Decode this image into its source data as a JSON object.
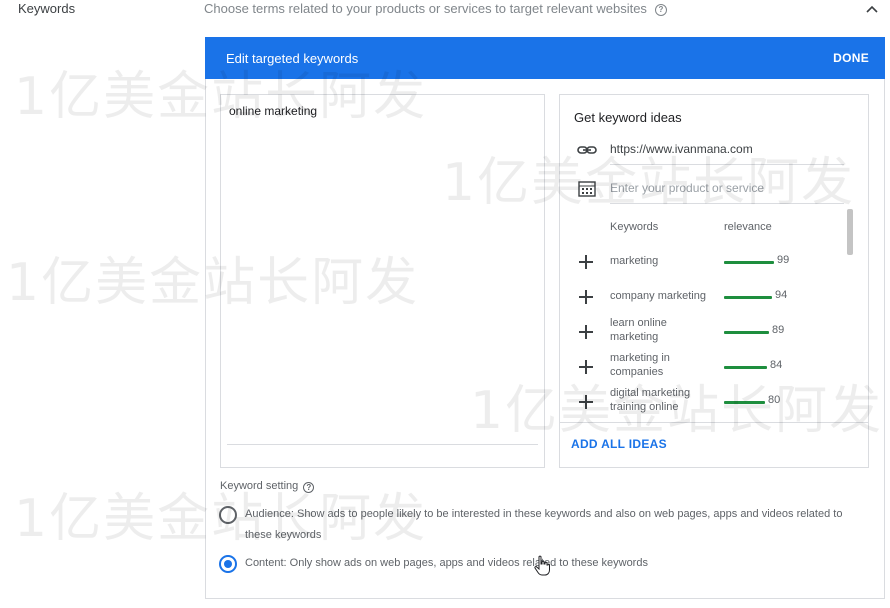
{
  "topbar": {
    "section_label": "Keywords",
    "description": "Choose terms related to your products or services to target relevant websites"
  },
  "panel": {
    "title": "Edit targeted keywords",
    "done_label": "DONE",
    "keywords_text": "online marketing"
  },
  "ideas": {
    "title": "Get keyword ideas",
    "url": "https://www.ivanmana.com",
    "product_placeholder": "Enter your product or service",
    "col_keywords": "Keywords",
    "col_relevance": "relevance",
    "suggestions": [
      {
        "keyword": "marketing",
        "relevance": "99"
      },
      {
        "keyword": "company marketing",
        "relevance": "94"
      },
      {
        "keyword": "learn online marketing",
        "relevance": "89"
      },
      {
        "keyword": "marketing in companies",
        "relevance": "84"
      },
      {
        "keyword": "digital marketing training online",
        "relevance": "80"
      }
    ],
    "add_all_label": "ADD ALL IDEAS"
  },
  "keyword_setting": {
    "label": "Keyword setting",
    "options": [
      {
        "text": "Audience: Show ads to people likely to be interested in these keywords and also on web pages, apps and videos related to these keywords",
        "selected": false
      },
      {
        "text": "Content: Only show ads on web pages, apps and videos related to these keywords",
        "selected": true
      }
    ]
  },
  "watermark": "1亿美金站长阿发",
  "colors": {
    "accent": "#1a73e8",
    "relevance_bar": "#1e8e3e"
  },
  "icons": {
    "help": "help-icon",
    "collapse": "chevron-up-icon",
    "link": "link-icon",
    "product": "building-icon",
    "add": "plus-icon"
  }
}
